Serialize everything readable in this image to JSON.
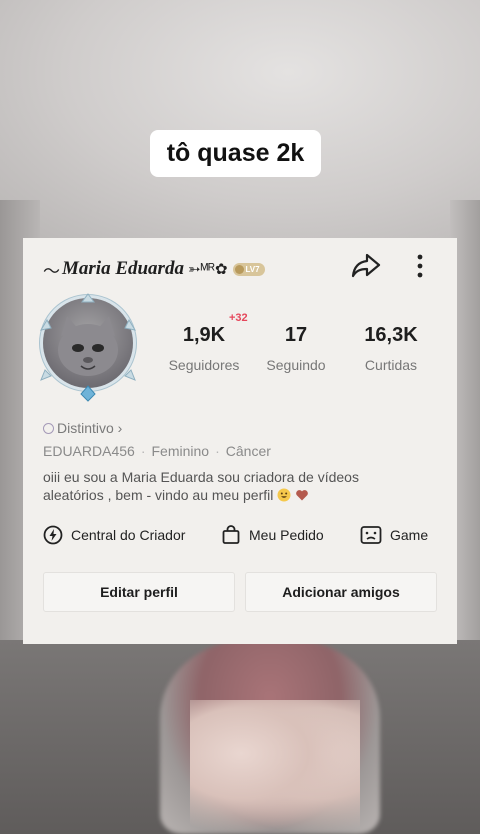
{
  "caption": "tô quase 2k",
  "profile": {
    "name_prefix": "〜",
    "name": "Maria Eduarda",
    "name_suffix": "➳ᴹᴿ✿",
    "level_badge": "LV7",
    "stats": [
      {
        "value": "1,9K",
        "label": "Seguidores",
        "delta": "+32"
      },
      {
        "value": "17",
        "label": "Seguindo"
      },
      {
        "value": "16,3K",
        "label": "Curtidas"
      }
    ],
    "distintivo": "Distintivo ›",
    "username": "EDUARDA456",
    "gender": "Feminino",
    "sign": "Câncer",
    "bio_line1": "oiii eu sou a Maria Eduarda sou criadora de vídeos",
    "bio_line2": "aleatórios , bem - vindo au meu perfil",
    "links": [
      {
        "label": "Central do Criador",
        "icon": "lightning-circle-icon"
      },
      {
        "label": "Meu Pedido",
        "icon": "shopping-bag-icon"
      },
      {
        "label": "Game",
        "icon": "gamepad-icon"
      }
    ],
    "buttons": {
      "edit": "Editar perfil",
      "add_friends": "Adicionar amigos"
    }
  },
  "colors": {
    "card_bg": "#f2f0ed",
    "delta_red": "#e5475b",
    "muted_text": "#8a8a8a"
  }
}
